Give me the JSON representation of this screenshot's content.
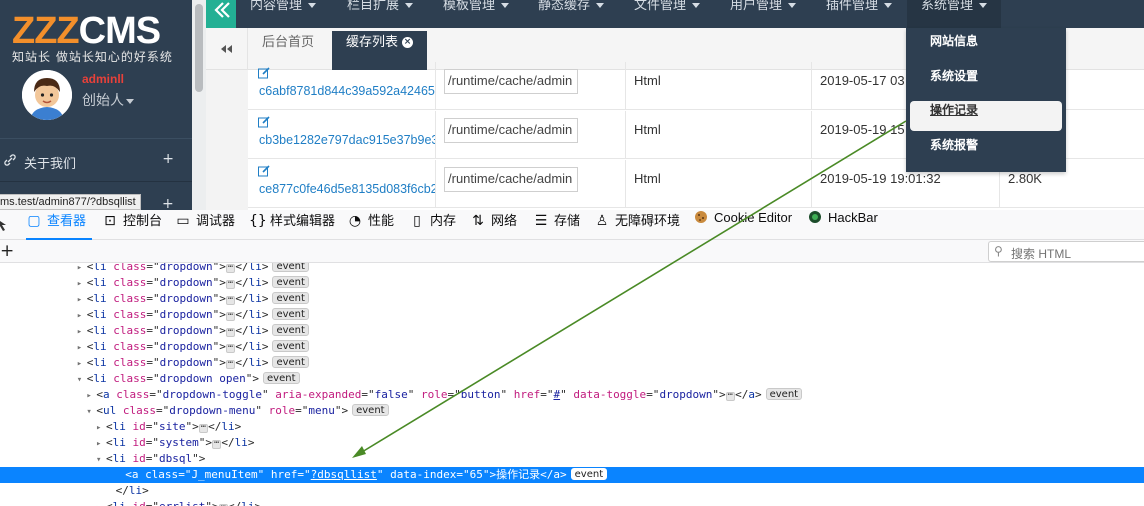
{
  "sidebar": {
    "logo_zz": "ZZZ",
    "logo_cms": "CMS",
    "slogan": "知站长 做站长知心的好系统",
    "username": "adminll",
    "role": "创始人",
    "menu_item": "关于我们",
    "plus": "+",
    "url_tooltip": "ms.test/admin877/?dbsqllist"
  },
  "topnav": {
    "items": [
      "内容管理",
      "栏目扩展",
      "模板管理",
      "静态缓存",
      "文件管理",
      "用户管理",
      "插件管理",
      "系统管理"
    ]
  },
  "tabs": {
    "home": "后台首页",
    "cache": "缓存列表",
    "close": "×"
  },
  "dropdown": {
    "items": [
      "网站信息",
      "系统设置",
      "操作记录",
      "系统报警"
    ]
  },
  "table": {
    "rows": [
      {
        "name": "c6abf8781d844c39a592a42465",
        "path": "/runtime/cache/admin",
        "type": "Html",
        "time": "2019-05-17 03",
        "size": ""
      },
      {
        "name": "cb3be1282e797dac915e37b9e3",
        "path": "/runtime/cache/admin",
        "type": "Html",
        "time": "2019-05-19 15",
        "size": ""
      },
      {
        "name": "ce877c0fe46d5e8135d083f6cb2",
        "path": "/runtime/cache/admin",
        "type": "Html",
        "time": "2019-05-19 19:01:32",
        "size": "2.80K"
      }
    ]
  },
  "devtools": {
    "tabs": [
      "查看器",
      "控制台",
      "调试器",
      "样式编辑器",
      "性能",
      "内存",
      "网络",
      "存储",
      "无障碍环境",
      "Cookie Editor",
      "HackBar"
    ],
    "search_placeholder": "搜索 HTML",
    "add": "+",
    "event_label": "event",
    "tree": {
      "li": "li",
      "a": "a",
      "ul": "ul",
      "class_attr": "class",
      "id_attr": "id",
      "dropdown": "dropdown",
      "dropdown_open": "dropdown open",
      "a_class": "dropdown-toggle",
      "aria_attr": "aria-expanded",
      "aria_val": "false",
      "role_attr": "role",
      "role_button": "button",
      "href_attr": "href",
      "href_hash": "#",
      "data_toggle_attr": "data-toggle",
      "data_toggle_val": "dropdown",
      "ul_class": "dropdown-menu",
      "role_menu": "menu",
      "id_site": "site",
      "id_system": "system",
      "id_dbsql": "dbsql",
      "id_errlist": "errlist",
      "sel_class": "J_menuItem",
      "sel_href": "?dbsqllist",
      "data_index_attr": "data-index",
      "data_index_val": "65",
      "sel_text": "操作记录"
    }
  },
  "colors": {
    "sidebar_bg": "#2e3f51",
    "accent_teal": "#23b094",
    "link_blue": "#1f7ec5",
    "logo_orange": "#f38f2b",
    "devtools_selection": "#0a84ff",
    "annotation_arrow": "#4a8a26"
  }
}
